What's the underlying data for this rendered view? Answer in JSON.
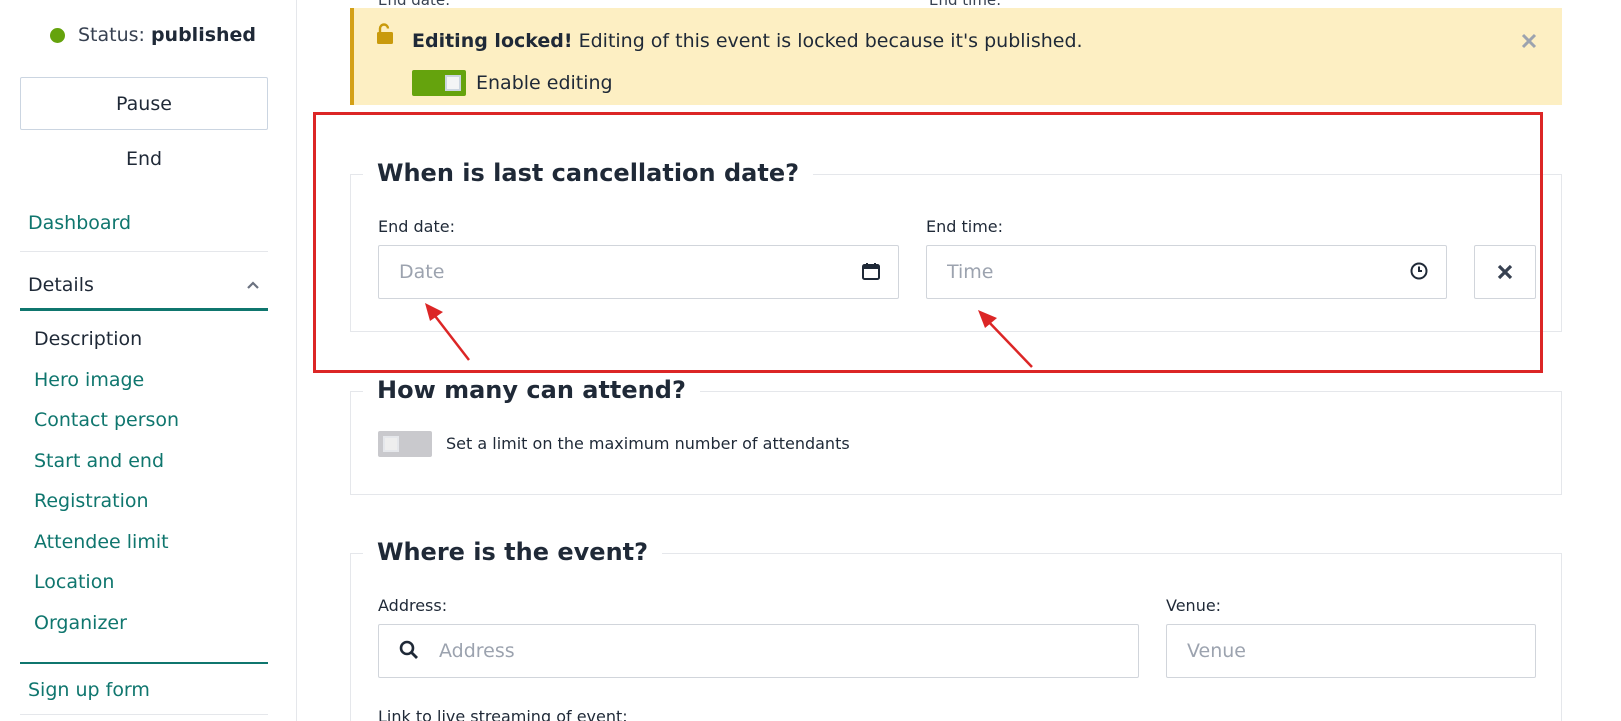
{
  "sidebar": {
    "status_label": "Status:",
    "status_value": "published",
    "status_color": "#65a30d",
    "pause_label": "Pause",
    "end_label": "End",
    "dashboard_label": "Dashboard",
    "details_label": "Details",
    "items": [
      {
        "label": "Description",
        "current": true
      },
      {
        "label": "Hero image"
      },
      {
        "label": "Contact person"
      },
      {
        "label": "Start and end"
      },
      {
        "label": "Registration"
      },
      {
        "label": "Attendee limit"
      },
      {
        "label": "Location"
      },
      {
        "label": "Organizer"
      }
    ],
    "signup_label": "Sign up form",
    "accent_color": "#0f766e"
  },
  "main": {
    "top_cut": {
      "end_date_label": "End date:",
      "end_time_label": "End time:"
    },
    "alert": {
      "title": "Editing locked!",
      "message": "Editing of this event is locked because it's published.",
      "toggle_label": "Enable editing",
      "toggle_on": true
    },
    "cancellation": {
      "heading": "When is last cancellation date?",
      "end_date_label": "End date:",
      "date_placeholder": "Date",
      "end_time_label": "End time:",
      "time_placeholder": "Time"
    },
    "attend": {
      "heading": "How many can attend?",
      "toggle_label": "Set a limit on the maximum number of attendants",
      "toggle_on": false
    },
    "location": {
      "heading": "Where is the event?",
      "address_label": "Address:",
      "address_placeholder": "Address",
      "venue_label": "Venue:",
      "venue_placeholder": "Venue",
      "stream_label": "Link to live streaming of event:"
    }
  },
  "annotation_color": "#dc2626"
}
